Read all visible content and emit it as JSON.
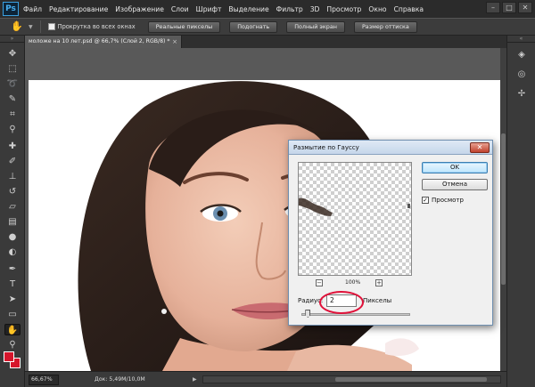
{
  "menubar": {
    "logo": "Ps",
    "items": [
      "Файл",
      "Редактирование",
      "Изображение",
      "Слои",
      "Шрифт",
      "Выделение",
      "Фильтр",
      "3D",
      "Просмотр",
      "Окно",
      "Справка"
    ],
    "window_controls": [
      "–",
      "□",
      "✕"
    ]
  },
  "options": {
    "scroll_all_label": "Прокрутка во всех окнах",
    "scroll_all_checked": false,
    "buttons": [
      "Реальные пикселы",
      "Подогнать",
      "Полный экран",
      "Размер оттиска"
    ]
  },
  "document": {
    "tab_title": "моложе на 10 лет.psd @ 66,7% (Слой 2, RGB/8) *",
    "close_glyph": "×"
  },
  "statusbar": {
    "zoom": "66,67%",
    "doc_info": "Док: 5,49M/10,0M",
    "arrow": "▶"
  },
  "colors": {
    "foreground": "#d6152b",
    "background": "#d6152b",
    "accent_ring": "#e0123a"
  },
  "tools": [
    "move-icon",
    "marquee-icon",
    "lasso-icon",
    "quick-select-icon",
    "crop-icon",
    "eyedropper-icon",
    "healing-icon",
    "brush-icon",
    "clone-stamp-icon",
    "history-brush-icon",
    "eraser-icon",
    "gradient-icon",
    "blur-icon",
    "dodge-icon",
    "pen-icon",
    "type-icon",
    "path-select-icon",
    "shape-icon",
    "hand-icon",
    "zoom-icon"
  ],
  "dialog": {
    "title": "Размытие по Гауссу",
    "close": "✕",
    "ok": "OK",
    "cancel": "Отмена",
    "preview_label": "Просмотр",
    "preview_checked": true,
    "zoom_minus": "−",
    "zoom_plus": "+",
    "zoom_pct": "100%",
    "radius_label": "Радиус:",
    "radius_value": "2",
    "radius_unit": "Пикселы",
    "slider_fraction": 0.06
  }
}
